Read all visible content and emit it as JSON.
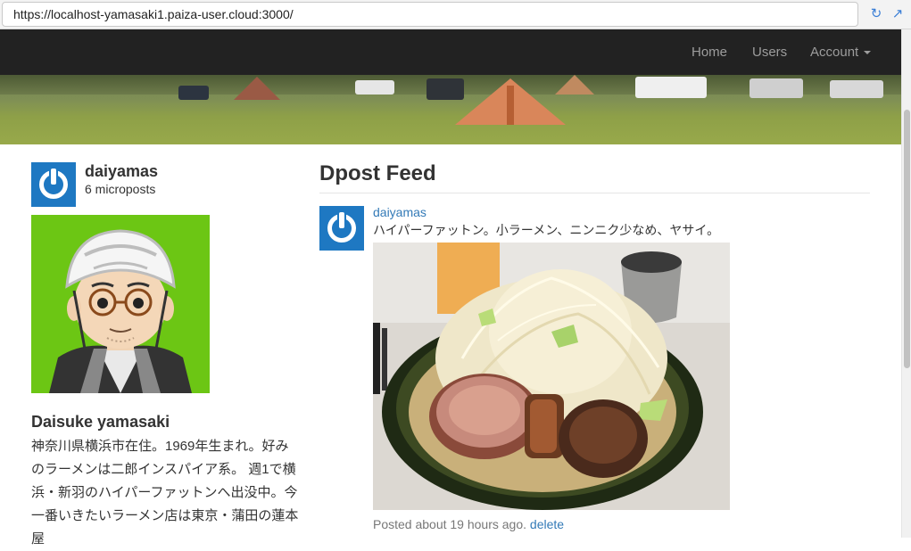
{
  "browser": {
    "url": "https://localhost-yamasaki1.paiza-user.cloud:3000/",
    "reload_icon": "reload-icon",
    "open_icon": "external-link-icon"
  },
  "navbar": {
    "items": [
      {
        "label": "Home"
      },
      {
        "label": "Users"
      },
      {
        "label": "Account"
      }
    ],
    "dropdown_icon": "caret-down-icon"
  },
  "user_info": {
    "name": "daiyamas",
    "microposts": "6 microposts"
  },
  "profile": {
    "name": "Daisuke yamasaki",
    "bio": "神奈川県横浜市在住。1969年生まれ。好みのラーメンは二郎インスパイア系。 週1で横浜・新羽のハイパーファットンへ出没中。今一番いきたいラーメン店は東京・蒲田の蓮本屋"
  },
  "feed": {
    "title": "Dpost Feed",
    "posts": [
      {
        "user": "daiyamas",
        "content": "ハイパーファットン。小ラーメン、ニンニク少なめ、ヤサイ。",
        "timestamp": "Posted about 19 hours ago.",
        "delete_label": "delete"
      }
    ]
  },
  "colors": {
    "navbar": "#222222",
    "link": "#337ab7",
    "gravatar": "#1e78c2",
    "avatar_bg": "#6cc614"
  }
}
